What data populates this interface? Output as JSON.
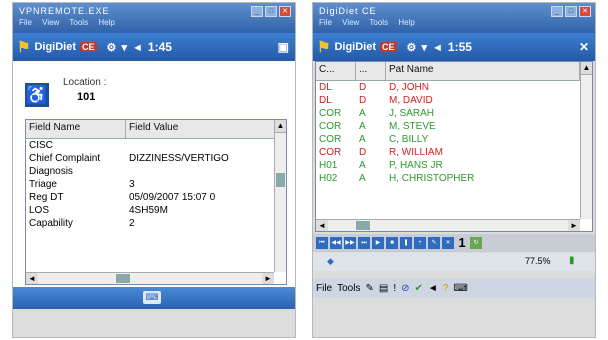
{
  "device1": {
    "window_title": "VPNREMOTE.EXE",
    "menu": [
      "File",
      "View",
      "Tools",
      "Help"
    ],
    "app_name": "DigiDiet",
    "app_tag": "CE",
    "status_text": "1:45",
    "location_label": "Location :",
    "location_value": "101",
    "columns": [
      "Field Name",
      "Field Value"
    ],
    "rows": [
      {
        "name": "CISC",
        "value": ""
      },
      {
        "name": "Chief Complaint",
        "value": "DIZZINESS/VERTIGO"
      },
      {
        "name": "Diagnosis",
        "value": ""
      },
      {
        "name": "Triage",
        "value": "3"
      },
      {
        "name": "Reg DT",
        "value": "05/09/2007 15:07 0"
      },
      {
        "name": "LOS",
        "value": "4SH59M"
      },
      {
        "name": "Capability",
        "value": "2"
      }
    ],
    "keyboard_icon": "keyboard-icon"
  },
  "device2": {
    "window_title": "DigiDiet CE",
    "menu": [
      "File",
      "View",
      "Tools",
      "Help"
    ],
    "app_name": "DigiDiet",
    "app_tag": "CE",
    "status_text": "1:55",
    "columns": [
      "C...",
      "...",
      "Pat Name"
    ],
    "rows": [
      {
        "c": "DL",
        "s": "D",
        "name": "D, JOHN",
        "color": "#d42020"
      },
      {
        "c": "DL",
        "s": "D",
        "name": "M, DAVID",
        "color": "#d42020"
      },
      {
        "c": "COR",
        "s": "A",
        "name": "J, SARAH",
        "color": "#2d9a2d"
      },
      {
        "c": "COR",
        "s": "A",
        "name": "M, STEVE",
        "color": "#2d9a2d"
      },
      {
        "c": "COR",
        "s": "A",
        "name": "C, BILLY",
        "color": "#2d9a2d"
      },
      {
        "c": "COR",
        "s": "D",
        "name": "R, WILLIAM",
        "color": "#d42020"
      },
      {
        "c": "H01",
        "s": "A",
        "name": "P, HANS JR",
        "color": "#2d9a2d"
      },
      {
        "c": "H02",
        "s": "A",
        "name": "H, CHRISTOPHER",
        "color": "#2d9a2d"
      }
    ],
    "record_number": "1",
    "memory_text": "77.5%",
    "bottom_menu": [
      "File",
      "Tools"
    ]
  }
}
